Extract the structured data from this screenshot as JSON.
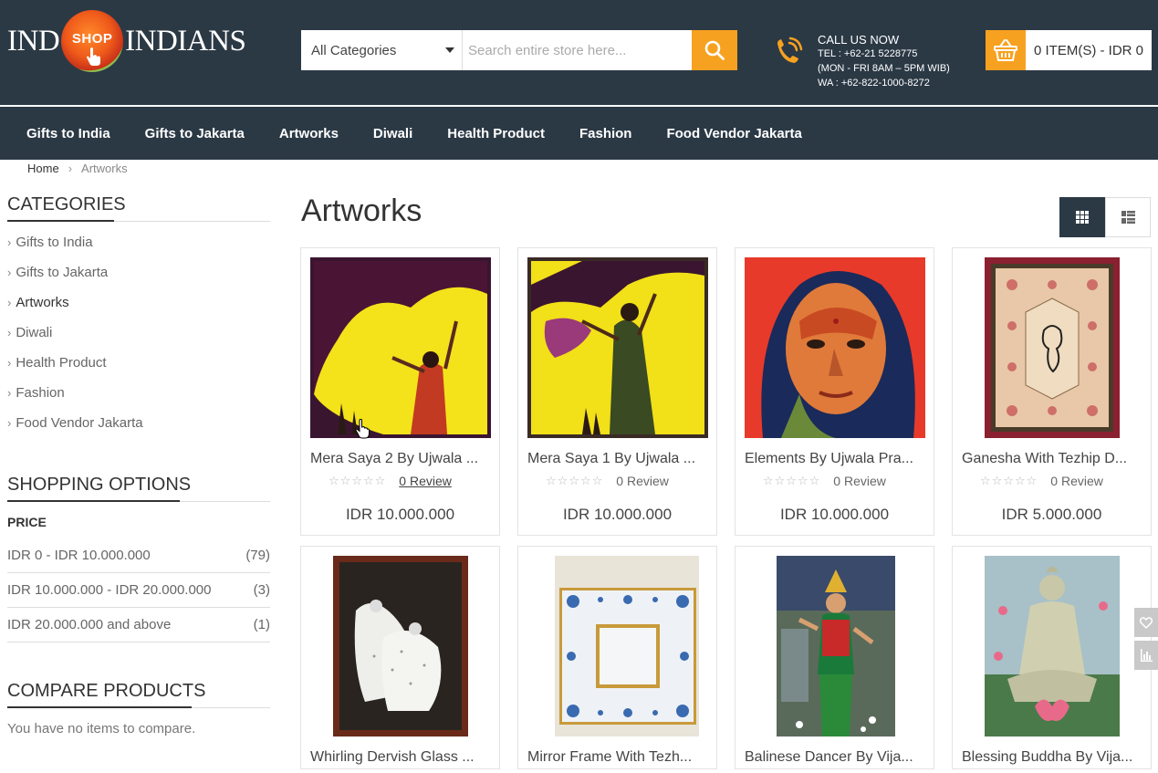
{
  "logo": {
    "left": "IND",
    "ball": "SHOP",
    "right": "INDIANS"
  },
  "search": {
    "category": "All Categories",
    "placeholder": "Search entire store here..."
  },
  "call": {
    "title": "CALL US NOW",
    "tel": "TEL : +62-21 5228775",
    "hours": "(MON - FRI 8AM – 5PM WIB)",
    "wa": "WA : +62-822-1000-8272"
  },
  "cart": {
    "label": "0 ITEM(S) - IDR 0"
  },
  "nav": [
    "Gifts to India",
    "Gifts to Jakarta",
    "Artworks",
    "Diwali",
    "Health Product",
    "Fashion",
    "Food Vendor Jakarta"
  ],
  "breadcrumb": {
    "home": "Home",
    "current": "Artworks"
  },
  "sidebar": {
    "categories_title": "CATEGORIES",
    "categories": [
      "Gifts to India",
      "Gifts to Jakarta",
      "Artworks",
      "Diwali",
      "Health Product",
      "Fashion",
      "Food Vendor Jakarta"
    ],
    "shopping_title": "SHOPPING OPTIONS",
    "price_label": "PRICE",
    "price_ranges": [
      {
        "label": "IDR 0 - IDR 10.000.000",
        "count": "(79)"
      },
      {
        "label": "IDR 10.000.000 - IDR 20.000.000",
        "count": "(3)"
      },
      {
        "label": "IDR 20.000.000 and above",
        "count": "(1)"
      }
    ],
    "compare_title": "COMPARE PRODUCTS",
    "compare_empty": "You have no items to compare."
  },
  "main": {
    "title": "Artworks"
  },
  "products": [
    {
      "name": "Mera Saya 2 By Ujwala ...",
      "review": "0 Review",
      "price": "IDR 10.000.000"
    },
    {
      "name": "Mera Saya 1 By Ujwala ...",
      "review": "0 Review",
      "price": "IDR 10.000.000"
    },
    {
      "name": "Elements By Ujwala Pra...",
      "review": "0 Review",
      "price": "IDR 10.000.000"
    },
    {
      "name": "Ganesha With Tezhip D...",
      "review": "0 Review",
      "price": "IDR 5.000.000"
    },
    {
      "name": "Whirling Dervish Glass ...",
      "review": "",
      "price": ""
    },
    {
      "name": "Mirror Frame With Tezh...",
      "review": "",
      "price": ""
    },
    {
      "name": "Balinese Dancer By Vija...",
      "review": "",
      "price": ""
    },
    {
      "name": "Blessing Buddha By Vija...",
      "review": "",
      "price": ""
    }
  ],
  "stars": "☆☆☆☆☆",
  "colors": {
    "header": "#2b3945",
    "accent": "#f7a120"
  }
}
